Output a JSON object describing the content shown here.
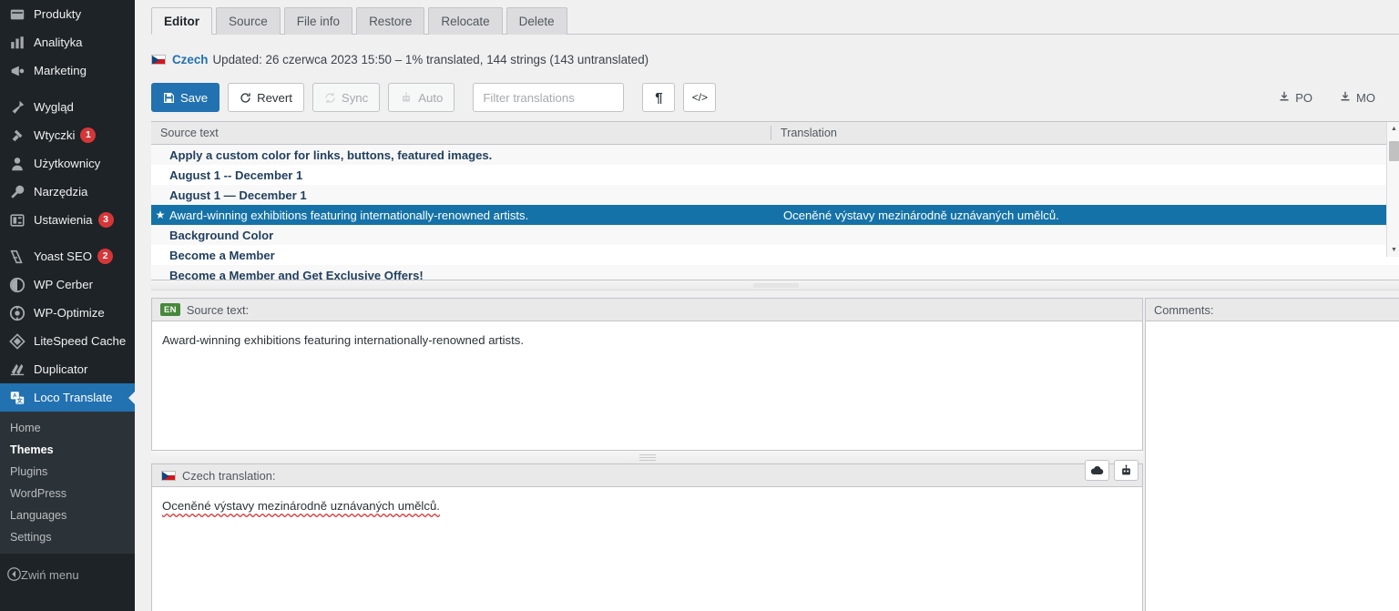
{
  "sidebar": {
    "items": [
      {
        "label": "Produkty",
        "icon": "products-icon",
        "badge": null,
        "active": false,
        "gap_after": false
      },
      {
        "label": "Analityka",
        "icon": "analytics-icon",
        "badge": null,
        "active": false,
        "gap_after": false
      },
      {
        "label": "Marketing",
        "icon": "marketing-icon",
        "badge": null,
        "active": false,
        "gap_after": true
      },
      {
        "label": "Wygląd",
        "icon": "appearance-icon",
        "badge": null,
        "active": false,
        "gap_after": false
      },
      {
        "label": "Wtyczki",
        "icon": "plugins-icon",
        "badge": "1",
        "active": false,
        "gap_after": false
      },
      {
        "label": "Użytkownicy",
        "icon": "users-icon",
        "badge": null,
        "active": false,
        "gap_after": false
      },
      {
        "label": "Narzędzia",
        "icon": "tools-icon",
        "badge": null,
        "active": false,
        "gap_after": false
      },
      {
        "label": "Ustawienia",
        "icon": "settings-icon",
        "badge": "3",
        "active": false,
        "gap_after": true
      },
      {
        "label": "Yoast SEO",
        "icon": "yoast-icon",
        "badge": "2",
        "active": false,
        "gap_after": false
      },
      {
        "label": "WP Cerber",
        "icon": "cerber-icon",
        "badge": null,
        "active": false,
        "gap_after": false
      },
      {
        "label": "WP-Optimize",
        "icon": "optimize-icon",
        "badge": null,
        "active": false,
        "gap_after": false
      },
      {
        "label": "LiteSpeed Cache",
        "icon": "litespeed-icon",
        "badge": null,
        "active": false,
        "gap_after": false
      },
      {
        "label": "Duplicator",
        "icon": "duplicator-icon",
        "badge": null,
        "active": false,
        "gap_after": false
      },
      {
        "label": "Loco Translate",
        "icon": "loco-translate-icon",
        "badge": null,
        "active": true,
        "gap_after": false
      }
    ],
    "submenu": [
      {
        "label": "Home",
        "current": false
      },
      {
        "label": "Themes",
        "current": true
      },
      {
        "label": "Plugins",
        "current": false
      },
      {
        "label": "WordPress",
        "current": false
      },
      {
        "label": "Languages",
        "current": false
      },
      {
        "label": "Settings",
        "current": false
      }
    ],
    "collapse_label": "Zwiń menu"
  },
  "tabs": [
    {
      "label": "Editor",
      "active": true
    },
    {
      "label": "Source",
      "active": false
    },
    {
      "label": "File info",
      "active": false
    },
    {
      "label": "Restore",
      "active": false
    },
    {
      "label": "Relocate",
      "active": false
    },
    {
      "label": "Delete",
      "active": false
    }
  ],
  "status": {
    "language": "Czech",
    "details": "Updated: 26 czerwca 2023 15:50 – 1% translated, 144 strings (143 untranslated)"
  },
  "toolbar": {
    "save_label": "Save",
    "revert_label": "Revert",
    "sync_label": "Sync",
    "auto_label": "Auto",
    "filter_placeholder": "Filter translations",
    "filter_value": "",
    "pilcrow_label": "¶",
    "code_label": "</>",
    "po_label": "PO",
    "mo_label": "MO"
  },
  "list": {
    "col_source": "Source text",
    "col_translation": "Translation",
    "rows": [
      {
        "source": "Apply a custom color for links, buttons, featured images.",
        "translation": "",
        "starred": false,
        "selected": false
      },
      {
        "source": "August 1 -- December 1",
        "translation": "",
        "starred": false,
        "selected": false
      },
      {
        "source": "August 1 — December 1",
        "translation": "",
        "starred": false,
        "selected": false
      },
      {
        "source": "Award-winning exhibitions featuring internationally-renowned artists.",
        "translation": "Oceněné výstavy mezinárodně uznávaných umělců.",
        "starred": true,
        "selected": true
      },
      {
        "source": "Background Color",
        "translation": "",
        "starred": false,
        "selected": false
      },
      {
        "source": "Become a Member",
        "translation": "",
        "starred": false,
        "selected": false
      },
      {
        "source": "Become a Member and Get Exclusive Offers!",
        "translation": "",
        "starred": false,
        "selected": false
      }
    ]
  },
  "source_panel": {
    "badge": "EN",
    "title": "Source text:",
    "text": "Award-winning exhibitions featuring internationally-renowned artists."
  },
  "translation_panel": {
    "title": "Czech translation:",
    "text": "Oceněné výstavy mezinárodně uznávaných umělců.",
    "cloud_icon": "cloud-icon",
    "robot_icon": "robot-icon"
  },
  "comments_panel": {
    "title": "Comments:",
    "text": ""
  },
  "colors": {
    "sidebar_bg": "#1d2327",
    "accent_blue": "#2271b1",
    "selection_blue": "#1572a8",
    "badge_red": "#d63638",
    "en_badge_green": "#46883b",
    "source_text_navy": "#22405f",
    "page_bg": "#f0f0f1"
  }
}
